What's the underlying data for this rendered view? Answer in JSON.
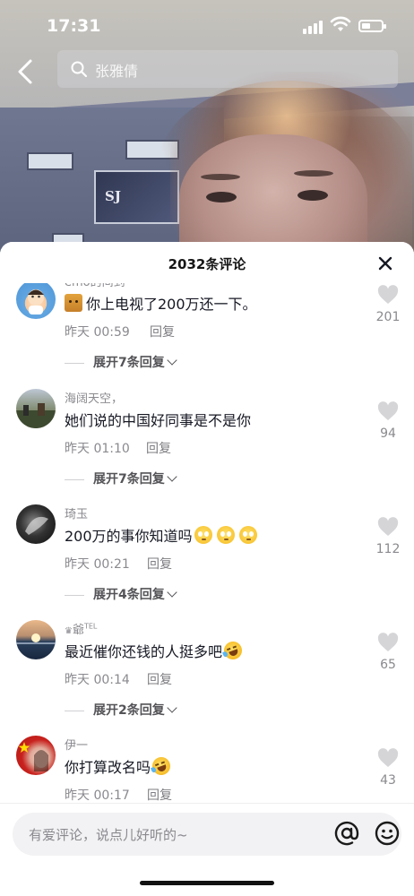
{
  "status_bar": {
    "time": "17:31"
  },
  "search": {
    "query": "张雅倩"
  },
  "video_overlay": {
    "sign_text": "SJ"
  },
  "comments_panel": {
    "title": "2032条评论",
    "comments": [
      {
        "username": "emo的间到",
        "text": "你上电视了200万还一下。",
        "leading_emoji": "cat-emoji",
        "trailing_emojis": [],
        "time": "昨天 00:59",
        "reply_label": "回复",
        "expand_label": "展开7条回复",
        "likes": "201"
      },
      {
        "username": "海阔天空，",
        "text": "她们说的中国好同事是不是你",
        "leading_emoji": "",
        "trailing_emojis": [],
        "time": "昨天 01:10",
        "reply_label": "回复",
        "expand_label": "展开7条回复",
        "likes": "94"
      },
      {
        "username": "琦玉",
        "text": "200万的事你知道吗",
        "leading_emoji": "",
        "trailing_emojis": [
          "pleading-face",
          "pleading-face",
          "pleading-face"
        ],
        "time": "昨天 00:21",
        "reply_label": "回复",
        "expand_label": "展开4条回复",
        "likes": "112"
      },
      {
        "username": "爺",
        "username_suffix": "TEL",
        "text": "最近催你还钱的人挺多吧",
        "leading_emoji": "",
        "trailing_emojis": [
          "rolling-laughing-face"
        ],
        "time": "昨天 00:14",
        "reply_label": "回复",
        "expand_label": "展开2条回复",
        "likes": "65"
      },
      {
        "username": "伊一",
        "text": "你打算改名吗",
        "leading_emoji": "",
        "trailing_emojis": [
          "rolling-laughing-face"
        ],
        "time": "昨天 00:17",
        "reply_label": "回复",
        "expand_label": "",
        "likes": "43"
      }
    ]
  },
  "comment_input": {
    "placeholder": "有爱评论，说点儿好听的~"
  },
  "icons": {
    "back": "chevron-left-icon",
    "search": "search-icon",
    "close": "close-icon",
    "like": "heart-icon",
    "mention": "at-icon",
    "emoji": "smiley-icon"
  },
  "colors": {
    "text_primary": "#161823",
    "text_secondary": "#8a8a8f",
    "like_icon": "#d5d5d8",
    "input_bg": "#f2f2f4"
  }
}
